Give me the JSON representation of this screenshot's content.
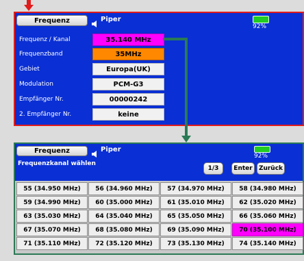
{
  "colors": {
    "screen_bg": "#0a2fd4",
    "frame_top": "#e11c1c",
    "frame_bottom": "#2a7a55",
    "highlight": "#ff00ff",
    "accent": "#ff8800",
    "arrow_red": "#e11c1c",
    "arrow_green": "#2a7a55",
    "battery": "#22cc22"
  },
  "top": {
    "tab_label": "Frequenz",
    "tab_icon": "speaker-icon",
    "title": "Piper",
    "battery": "92%",
    "rows": [
      {
        "label": "Frequenz / Kanal",
        "value": "35.140 MHz"
      },
      {
        "label": "Frequenzband",
        "value": "35MHz"
      },
      {
        "label": "Gebiet",
        "value": "Europa(UK)"
      },
      {
        "label": "Modulation",
        "value": "PCM-G3"
      },
      {
        "label": "Empfänger Nr.",
        "value": "00000242"
      },
      {
        "label": "2. Empfänger Nr.",
        "value": "keine"
      }
    ]
  },
  "bottom": {
    "tab_label": "Frequenz",
    "tab_icon": "speaker-icon",
    "title": "Piper",
    "battery": "92%",
    "subtitle": "Frequenzkanal wählen",
    "page": "1/3",
    "enter": "Enter",
    "back": "Zurück",
    "channels": [
      "55 (34.950 MHz)",
      "56 (34.960 MHz)",
      "57 (34.970 MHz)",
      "58 (34.980 MHz)",
      "59 (34.990 MHz)",
      "60 (35.000 MHz)",
      "61 (35.010 MHz)",
      "62 (35.020 MHz)",
      "63 (35.030 MHz)",
      "64 (35.040 MHz)",
      "65 (35.050 MHz)",
      "66 (35.060 MHz)",
      "67 (35.070 MHz)",
      "68 (35.080 MHz)",
      "69 (35.090 MHz)",
      "70 (35.100 MHz)",
      "71 (35.110 MHz)",
      "72 (35.120 MHz)",
      "73 (35.130 MHz)",
      "74 (35.140 MHz)"
    ],
    "selected_index": 15
  }
}
